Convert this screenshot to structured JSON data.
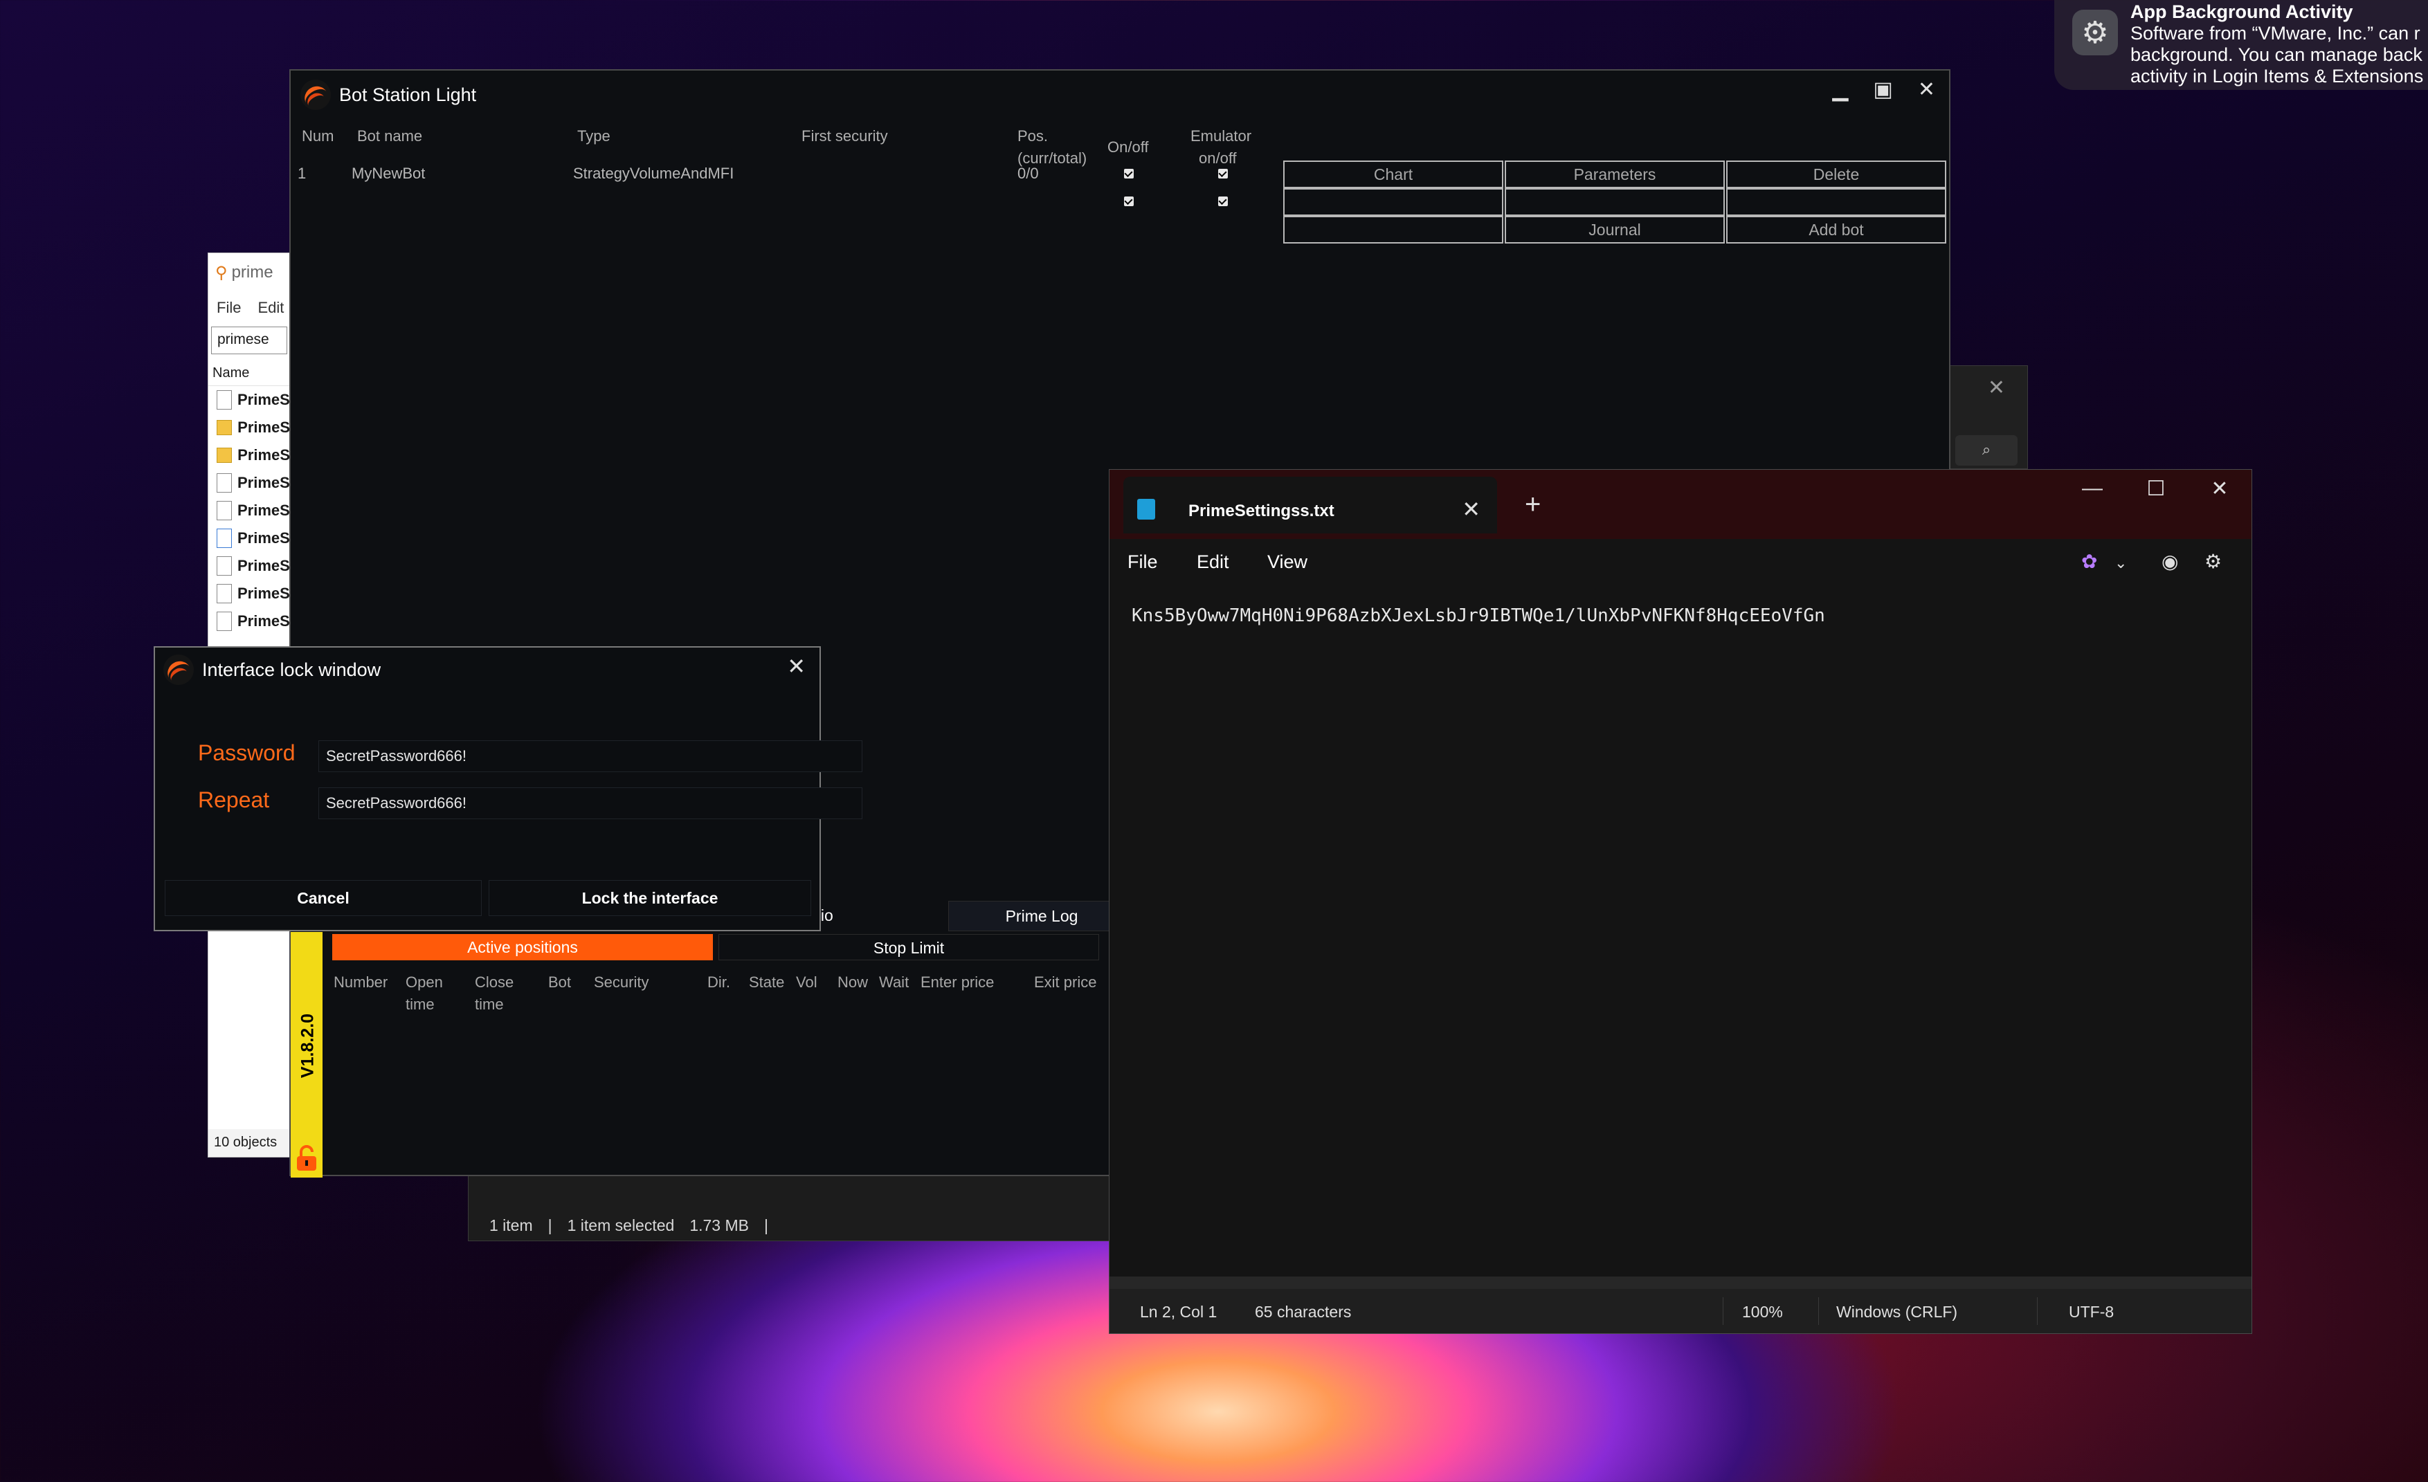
{
  "notification": {
    "title": "App Background Activity",
    "line1": "Software from “VMware, Inc.” can r",
    "line2": "background. You can manage back",
    "line3": "activity in Login Items & Extensions"
  },
  "explorer_behind": {
    "title": "prime",
    "menu": [
      "File",
      "Edit"
    ],
    "address": "primese",
    "column_header": "Name",
    "items": [
      "PrimeS",
      "PrimeS",
      "PrimeS",
      "PrimeS",
      "PrimeS",
      "PrimeS",
      "PrimeS",
      "PrimeS",
      "PrimeS"
    ],
    "status": "10 objects"
  },
  "file_explorer_status": {
    "items": "1 item",
    "selected": "1 item selected",
    "size": "1.73 MB"
  },
  "bot_station": {
    "title": "Bot Station Light",
    "columns": {
      "num": "Num",
      "bot_name": "Bot name",
      "type": "Type",
      "first_security": "First security",
      "pos": "Pos.",
      "pos_sub": "(curr/total)",
      "onoff": "On/off",
      "emulator": "Emulator",
      "emulator_sub": "on/off"
    },
    "rows": [
      {
        "num": "1",
        "bot_name": "MyNewBot",
        "type": "StrategyVolumeAndMFI",
        "pos": "0/0"
      }
    ],
    "buttons": {
      "chart": "Chart",
      "parameters": "Parameters",
      "delete": "Delete",
      "journal": "Journal",
      "add_bot": "Add bot"
    },
    "version": "V1.8.2.0",
    "tabs": {
      "portfolio": "olio",
      "prime_log": "Prime Log"
    },
    "subtabs": {
      "active": "Active positions",
      "stop_limit": "Stop Limit"
    },
    "position_columns": {
      "number": "Number",
      "open_time": "Open time",
      "close_time": "Close time",
      "bot": "Bot",
      "security": "Security",
      "dir": "Dir.",
      "state": "State",
      "vol": "Vol",
      "now": "Now",
      "wait": "Wait",
      "enter_price": "Enter price",
      "exit_price": "Exit price"
    }
  },
  "lock_window": {
    "title": "Interface lock window",
    "password_label": "Password",
    "password_value": "SecretPassword666!",
    "repeat_label": "Repeat",
    "repeat_value": "SecretPassword666!",
    "cancel": "Cancel",
    "lock": "Lock the interface"
  },
  "notepad": {
    "tab_name": "PrimeSettingss.txt",
    "menu": {
      "file": "File",
      "edit": "Edit",
      "view": "View"
    },
    "content": "Kns5ByOww7MqH0Ni9P68AzbXJexLsbJr9IBTWQe1/lUnXbPvNFKNf8HqcEEoVfGn",
    "status": {
      "position": "Ln 2, Col 1",
      "chars": "65 characters",
      "zoom": "100%",
      "line_ending": "Windows (CRLF)",
      "encoding": "UTF-8"
    }
  }
}
